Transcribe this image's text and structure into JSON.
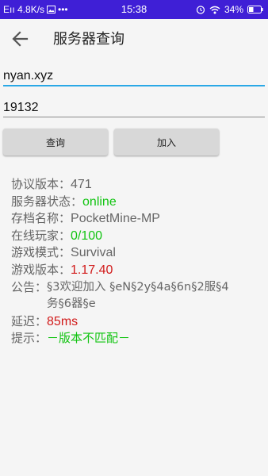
{
  "status_bar": {
    "left": "Eıı 4.8K/s",
    "time": "15:38",
    "battery": "34%"
  },
  "app_bar": {
    "title": "服务器查询",
    "back_icon": "arrow-back-icon"
  },
  "form": {
    "host_value": "nyan.xyz",
    "port_value": "19132"
  },
  "buttons": {
    "query": "查询",
    "join": "加入"
  },
  "info": {
    "protocol_label": "协议版本：",
    "protocol_value": "471",
    "status_label": "服务器状态：",
    "status_value": "online",
    "save_label": "存档名称：",
    "save_value": "PocketMine-MP",
    "players_label": "在线玩家：",
    "players_value": "0/100",
    "mode_label": "游戏模式：",
    "mode_value": "Survival",
    "version_label": "游戏版本：",
    "version_value": "1.17.40",
    "notice_label": "公告：",
    "notice_value": "§3欢迎加入 §eN§2y§4a§6n§2服§4务§6器§e",
    "latency_label": "延迟：",
    "latency_value": "85ms",
    "hint_label": "提示：",
    "hint_value": "－版本不匹配－"
  },
  "colors": {
    "status_bar": "#3f1fd6",
    "accent_line": "#2aa8e6",
    "online": "#11c411",
    "warning": "#d11a1a"
  }
}
